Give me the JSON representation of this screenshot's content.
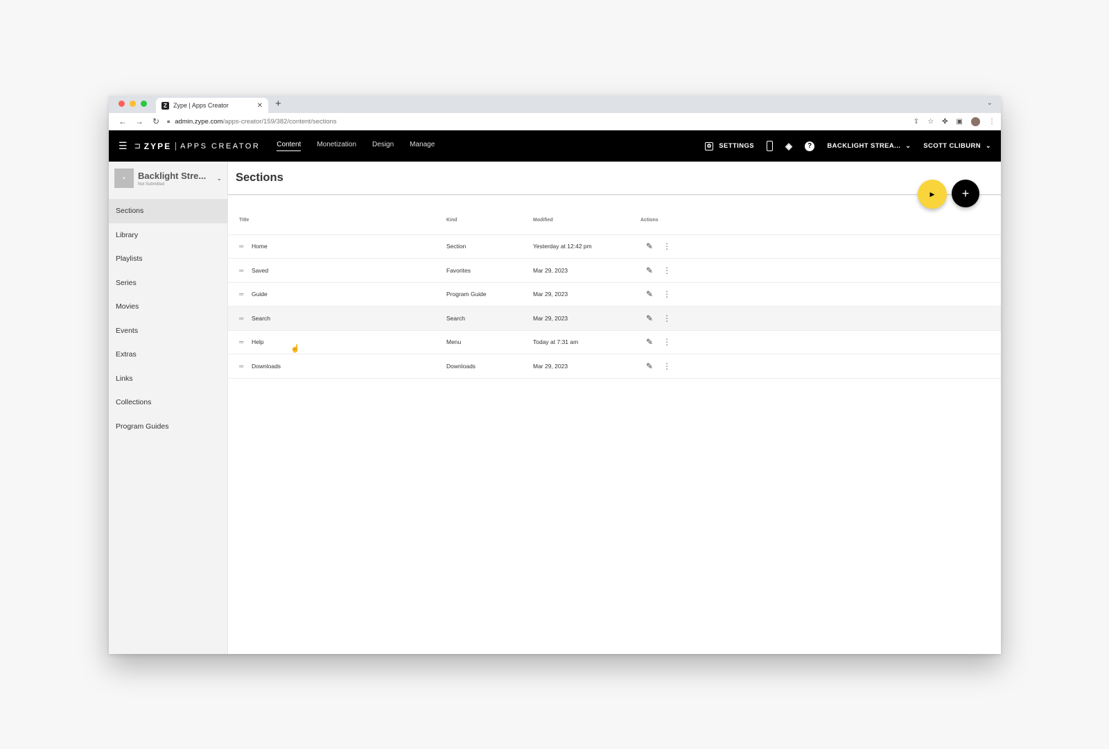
{
  "browser": {
    "tab_title": "Zype | Apps Creator",
    "favicon_letter": "Z",
    "url_host": "admin.zype.com",
    "url_path": "/apps-creator/159/382/content/sections"
  },
  "app": {
    "logo_mark": "⊑̲",
    "logo_text": "ZYPE",
    "logo_sub": "APPS CREATOR",
    "nav": [
      {
        "label": "Content",
        "active": true
      },
      {
        "label": "Monetization",
        "active": false
      },
      {
        "label": "Design",
        "active": false
      },
      {
        "label": "Manage",
        "active": false
      }
    ],
    "settings_label": "SETTINGS",
    "account_label": "BACKLIGHT STREA...",
    "user_label": "SCOTT CLIBURN",
    "accent_color": "#f9d43b"
  },
  "sidebar": {
    "app_name": "Backlight Stre...",
    "app_status": "Not Submitted",
    "items": [
      {
        "label": "Sections",
        "active": true
      },
      {
        "label": "Library"
      },
      {
        "label": "Playlists"
      },
      {
        "label": "Series"
      },
      {
        "label": "Movies"
      },
      {
        "label": "Events"
      },
      {
        "label": "Extras"
      },
      {
        "label": "Links"
      },
      {
        "label": "Collections"
      },
      {
        "label": "Program Guides"
      }
    ]
  },
  "main": {
    "title": "Sections",
    "columns": {
      "title": "Title",
      "kind": "Kind",
      "modified": "Modified",
      "actions": "Actions"
    },
    "rows": [
      {
        "title": "Home",
        "kind": "Section",
        "modified": "Yesterday at 12:42 pm"
      },
      {
        "title": "Saved",
        "kind": "Favorites",
        "modified": "Mar 29, 2023"
      },
      {
        "title": "Guide",
        "kind": "Program Guide",
        "modified": "Mar 29, 2023"
      },
      {
        "title": "Search",
        "kind": "Search",
        "modified": "Mar 29, 2023"
      },
      {
        "title": "Help",
        "kind": "Menu",
        "modified": "Today at 7:31 am"
      },
      {
        "title": "Downloads",
        "kind": "Downloads",
        "modified": "Mar 29, 2023"
      }
    ]
  }
}
